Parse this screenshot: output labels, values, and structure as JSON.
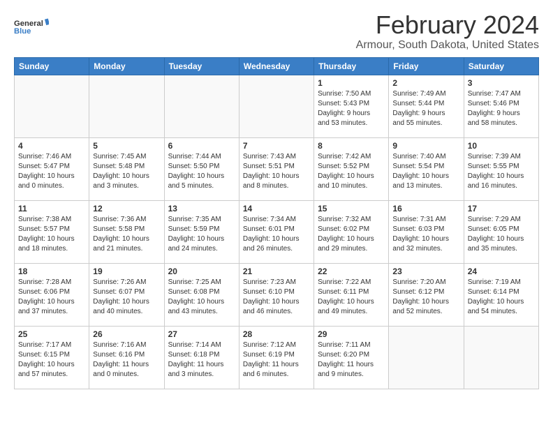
{
  "logo": {
    "general": "General",
    "blue": "Blue"
  },
  "header": {
    "title": "February 2024",
    "subtitle": "Armour, South Dakota, United States"
  },
  "weekdays": [
    "Sunday",
    "Monday",
    "Tuesday",
    "Wednesday",
    "Thursday",
    "Friday",
    "Saturday"
  ],
  "weeks": [
    [
      {
        "day": "",
        "info": ""
      },
      {
        "day": "",
        "info": ""
      },
      {
        "day": "",
        "info": ""
      },
      {
        "day": "",
        "info": ""
      },
      {
        "day": "1",
        "info": "Sunrise: 7:50 AM\nSunset: 5:43 PM\nDaylight: 9 hours\nand 53 minutes."
      },
      {
        "day": "2",
        "info": "Sunrise: 7:49 AM\nSunset: 5:44 PM\nDaylight: 9 hours\nand 55 minutes."
      },
      {
        "day": "3",
        "info": "Sunrise: 7:47 AM\nSunset: 5:46 PM\nDaylight: 9 hours\nand 58 minutes."
      }
    ],
    [
      {
        "day": "4",
        "info": "Sunrise: 7:46 AM\nSunset: 5:47 PM\nDaylight: 10 hours\nand 0 minutes."
      },
      {
        "day": "5",
        "info": "Sunrise: 7:45 AM\nSunset: 5:48 PM\nDaylight: 10 hours\nand 3 minutes."
      },
      {
        "day": "6",
        "info": "Sunrise: 7:44 AM\nSunset: 5:50 PM\nDaylight: 10 hours\nand 5 minutes."
      },
      {
        "day": "7",
        "info": "Sunrise: 7:43 AM\nSunset: 5:51 PM\nDaylight: 10 hours\nand 8 minutes."
      },
      {
        "day": "8",
        "info": "Sunrise: 7:42 AM\nSunset: 5:52 PM\nDaylight: 10 hours\nand 10 minutes."
      },
      {
        "day": "9",
        "info": "Sunrise: 7:40 AM\nSunset: 5:54 PM\nDaylight: 10 hours\nand 13 minutes."
      },
      {
        "day": "10",
        "info": "Sunrise: 7:39 AM\nSunset: 5:55 PM\nDaylight: 10 hours\nand 16 minutes."
      }
    ],
    [
      {
        "day": "11",
        "info": "Sunrise: 7:38 AM\nSunset: 5:57 PM\nDaylight: 10 hours\nand 18 minutes."
      },
      {
        "day": "12",
        "info": "Sunrise: 7:36 AM\nSunset: 5:58 PM\nDaylight: 10 hours\nand 21 minutes."
      },
      {
        "day": "13",
        "info": "Sunrise: 7:35 AM\nSunset: 5:59 PM\nDaylight: 10 hours\nand 24 minutes."
      },
      {
        "day": "14",
        "info": "Sunrise: 7:34 AM\nSunset: 6:01 PM\nDaylight: 10 hours\nand 26 minutes."
      },
      {
        "day": "15",
        "info": "Sunrise: 7:32 AM\nSunset: 6:02 PM\nDaylight: 10 hours\nand 29 minutes."
      },
      {
        "day": "16",
        "info": "Sunrise: 7:31 AM\nSunset: 6:03 PM\nDaylight: 10 hours\nand 32 minutes."
      },
      {
        "day": "17",
        "info": "Sunrise: 7:29 AM\nSunset: 6:05 PM\nDaylight: 10 hours\nand 35 minutes."
      }
    ],
    [
      {
        "day": "18",
        "info": "Sunrise: 7:28 AM\nSunset: 6:06 PM\nDaylight: 10 hours\nand 37 minutes."
      },
      {
        "day": "19",
        "info": "Sunrise: 7:26 AM\nSunset: 6:07 PM\nDaylight: 10 hours\nand 40 minutes."
      },
      {
        "day": "20",
        "info": "Sunrise: 7:25 AM\nSunset: 6:08 PM\nDaylight: 10 hours\nand 43 minutes."
      },
      {
        "day": "21",
        "info": "Sunrise: 7:23 AM\nSunset: 6:10 PM\nDaylight: 10 hours\nand 46 minutes."
      },
      {
        "day": "22",
        "info": "Sunrise: 7:22 AM\nSunset: 6:11 PM\nDaylight: 10 hours\nand 49 minutes."
      },
      {
        "day": "23",
        "info": "Sunrise: 7:20 AM\nSunset: 6:12 PM\nDaylight: 10 hours\nand 52 minutes."
      },
      {
        "day": "24",
        "info": "Sunrise: 7:19 AM\nSunset: 6:14 PM\nDaylight: 10 hours\nand 54 minutes."
      }
    ],
    [
      {
        "day": "25",
        "info": "Sunrise: 7:17 AM\nSunset: 6:15 PM\nDaylight: 10 hours\nand 57 minutes."
      },
      {
        "day": "26",
        "info": "Sunrise: 7:16 AM\nSunset: 6:16 PM\nDaylight: 11 hours\nand 0 minutes."
      },
      {
        "day": "27",
        "info": "Sunrise: 7:14 AM\nSunset: 6:18 PM\nDaylight: 11 hours\nand 3 minutes."
      },
      {
        "day": "28",
        "info": "Sunrise: 7:12 AM\nSunset: 6:19 PM\nDaylight: 11 hours\nand 6 minutes."
      },
      {
        "day": "29",
        "info": "Sunrise: 7:11 AM\nSunset: 6:20 PM\nDaylight: 11 hours\nand 9 minutes."
      },
      {
        "day": "",
        "info": ""
      },
      {
        "day": "",
        "info": ""
      }
    ]
  ]
}
